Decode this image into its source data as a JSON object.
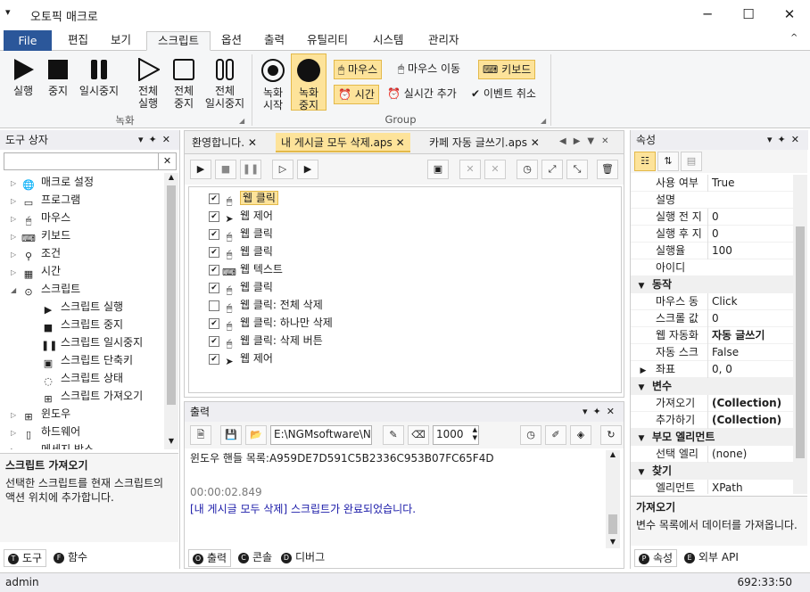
{
  "window": {
    "title": "오토픽 매크로",
    "sysmenu_glyph": "▾",
    "minimize": "─",
    "maximize": "☐",
    "close": "✕"
  },
  "ribbon_tabs": [
    "File",
    "편집",
    "보기",
    "스크립트",
    "옵션",
    "출력",
    "유틸리티",
    "시스템",
    "관리자"
  ],
  "ribbon_collapse": "^",
  "ribbon": {
    "exec": {
      "run": "실행",
      "stop": "중지",
      "pause": "일시중지",
      "run_all": "전체\n실행",
      "stop_all": "전체\n중지",
      "pause_all": "전체\n일시중지",
      "group": "녹화"
    },
    "record": {
      "rec_start": "녹화\n시작",
      "rec_stop": "녹화\n중지",
      "mouse": "마우스",
      "mouse_move": "마우스 이동",
      "keyboard": "키보드",
      "time": "시간",
      "realtime_add": "실시간 추가",
      "event_cancel": "이벤트 취소",
      "group": "Group"
    }
  },
  "toolbox": {
    "title": "도구 상자",
    "items": [
      {
        "label": "매크로 설정",
        "icon": "globe-icon",
        "expanded": false
      },
      {
        "label": "프로그램",
        "icon": "program-icon",
        "expanded": false
      },
      {
        "label": "마우스",
        "icon": "mouse-icon",
        "expanded": false
      },
      {
        "label": "키보드",
        "icon": "keyboard-icon",
        "expanded": false
      },
      {
        "label": "조건",
        "icon": "condition-icon",
        "expanded": false
      },
      {
        "label": "시간",
        "icon": "calendar-icon",
        "expanded": false
      },
      {
        "label": "스크립트",
        "icon": "script-icon",
        "expanded": true
      },
      {
        "label": "스크립트 실행",
        "icon": "play-icon",
        "child": true
      },
      {
        "label": "스크립트 중지",
        "icon": "stop-icon",
        "child": true
      },
      {
        "label": "스크립트 일시중지",
        "icon": "pause-icon",
        "child": true
      },
      {
        "label": "스크립트 단축키",
        "icon": "hotkey-icon",
        "child": true
      },
      {
        "label": "스크립트 상태",
        "icon": "status-icon",
        "child": true
      },
      {
        "label": "스크립트 가져오기",
        "icon": "import-icon",
        "child": true
      },
      {
        "label": "윈도우",
        "icon": "windows-icon",
        "expanded": false
      },
      {
        "label": "하드웨어",
        "icon": "hardware-icon",
        "expanded": false
      },
      {
        "label": "메세지 박스",
        "icon": "messagebox-icon",
        "expanded": false
      }
    ],
    "desc_title": "스크립트 가져오기",
    "desc_text": "선택한 스크립트를 현재 스크립트의 액션 위치에 추가합니다.",
    "tabs": [
      "도구",
      "함수"
    ],
    "tab_badges": [
      "T",
      "F"
    ]
  },
  "doc_tabs": [
    "환영합니다.",
    "내 게시글 모두 삭제.aps",
    "카페 자동 글쓰기.aps"
  ],
  "script_steps": [
    {
      "label": "웹 클릭",
      "checked": true,
      "icon": "mouse-icon",
      "selected": true
    },
    {
      "label": "웹 제어",
      "checked": true,
      "icon": "control-icon"
    },
    {
      "label": "웹 클릭",
      "checked": true,
      "icon": "mouse-icon"
    },
    {
      "label": "웹 클릭",
      "checked": true,
      "icon": "mouse-icon"
    },
    {
      "label": "웹 텍스트",
      "checked": true,
      "icon": "keyboard-icon"
    },
    {
      "label": "웹 클릭",
      "checked": true,
      "icon": "mouse-icon"
    },
    {
      "label": "웹 클릭: 전체 삭제",
      "checked": false,
      "icon": "mouse-icon"
    },
    {
      "label": "웹 클릭: 하나만 삭제",
      "checked": true,
      "icon": "mouse-icon"
    },
    {
      "label": "웹 클릭: 삭제 버튼",
      "checked": true,
      "icon": "mouse-icon"
    },
    {
      "label": "웹 제어",
      "checked": true,
      "icon": "control-icon"
    }
  ],
  "output": {
    "title": "출력",
    "path": "E:\\NGMsoftware\\NG",
    "count": "1000",
    "lines": [
      {
        "text": "윈도우 핸들 목록:A959DE7D591C5B2336C953B07FC65F4D",
        "color": "#1e1e1e"
      },
      {
        "text": "",
        "color": "#1e1e1e"
      },
      {
        "text": "00:00:02.849",
        "color": "#7a7a7a"
      },
      {
        "text": "[내 게시글 모두 삭제] 스크립트가 완료되었습니다.",
        "color": "#1a1aa8"
      }
    ],
    "tabs": [
      "출력",
      "콘솔",
      "디버그"
    ],
    "tab_badges": [
      "O",
      "C",
      "D"
    ]
  },
  "properties": {
    "title": "속성",
    "rows": [
      {
        "type": "row",
        "name": "사용 여부",
        "value": "True"
      },
      {
        "type": "row",
        "name": "설명",
        "value": ""
      },
      {
        "type": "row",
        "name": "실행 전 지",
        "value": "0"
      },
      {
        "type": "row",
        "name": "실행 후 지",
        "value": "0"
      },
      {
        "type": "row",
        "name": "실행율",
        "value": "100"
      },
      {
        "type": "row",
        "name": "아이디",
        "value": ""
      },
      {
        "type": "cat",
        "name": "동작"
      },
      {
        "type": "row",
        "name": "마우스 동",
        "value": "Click"
      },
      {
        "type": "row",
        "name": "스크롤 값",
        "value": "0"
      },
      {
        "type": "row",
        "name": "웹 자동화",
        "value": "자동 글쓰기",
        "bold": true
      },
      {
        "type": "row",
        "name": "자동 스크",
        "value": "False"
      },
      {
        "type": "row",
        "name": "좌표",
        "value": "0, 0",
        "expand": true
      },
      {
        "type": "cat",
        "name": "변수"
      },
      {
        "type": "row",
        "name": "가져오기",
        "value": "(Collection)",
        "bold": true
      },
      {
        "type": "row",
        "name": "추가하기",
        "value": "(Collection)",
        "bold": true
      },
      {
        "type": "cat",
        "name": "부모 엘리먼트"
      },
      {
        "type": "row",
        "name": "선택 엘리",
        "value": "(none)"
      },
      {
        "type": "cat",
        "name": "찾기"
      },
      {
        "type": "row",
        "name": "엘리먼트",
        "value": "XPath"
      }
    ],
    "desc_title": "가져오기",
    "desc_text": "변수 목록에서 데이터를 가져옵니다.",
    "tabs": [
      "속성",
      "외부 API"
    ],
    "tab_badges": [
      "P",
      "E"
    ]
  },
  "status": {
    "user": "admin",
    "coords": "692:33:50"
  }
}
